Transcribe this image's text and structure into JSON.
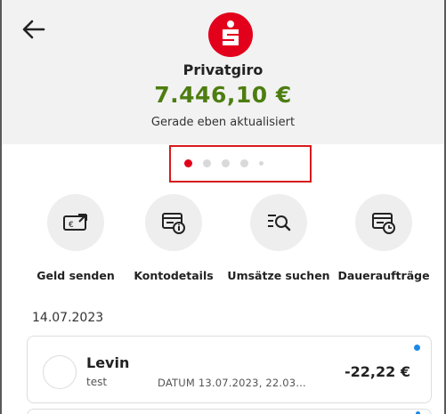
{
  "header": {
    "back_icon": "arrow-left-icon",
    "logo": "sparkasse-logo",
    "account_name": "Privatgiro",
    "balance": "7.446,10 €",
    "balance_color": "#4d7d10",
    "updated_text": "Gerade eben aktualisiert"
  },
  "pager": {
    "active_index": 0,
    "count": 5,
    "active_color": "#e3001b"
  },
  "actions": [
    {
      "label": "Geld senden",
      "icon": "send-money-icon"
    },
    {
      "label": "Kontodetails",
      "icon": "account-details-icon"
    },
    {
      "label": "Umsätze suchen",
      "icon": "search-transactions-icon"
    },
    {
      "label": "Daueraufträge",
      "icon": "standing-orders-icon"
    }
  ],
  "transactions": {
    "date": "14.07.2023",
    "items": [
      {
        "name": "Levin",
        "reference": "test",
        "date_text": "DATUM 13.07.2023, 22.03...",
        "amount": "-22,22 €",
        "unread": true
      }
    ]
  },
  "colors": {
    "brand_red": "#e3001b",
    "highlight_box": "#d7191c",
    "unread_dot": "#1e88e5"
  }
}
